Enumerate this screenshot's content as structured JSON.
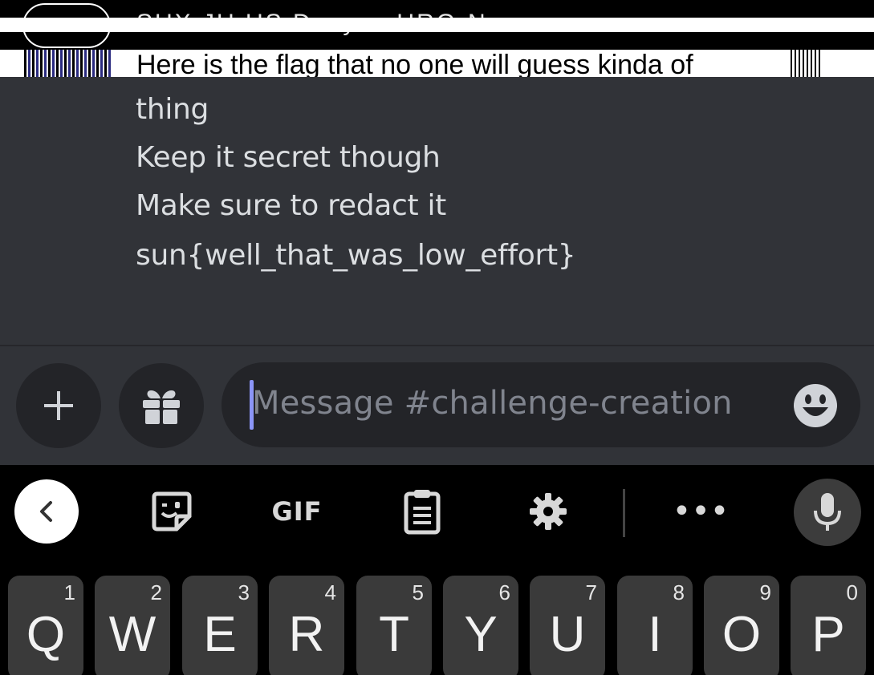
{
  "header": {
    "garbled_top": "SUX JU US Dcayaz URG-N",
    "garbled_line_prefix": "Here is the flag that no one will",
    "garbled_line_clear": " guess ",
    "garbled_line_suffix": "kinda of"
  },
  "message": {
    "lines": [
      "thing",
      "Keep it secret though",
      "Make sure to redact it",
      "sun{well_that_was_low_effort}"
    ]
  },
  "composer": {
    "placeholder": "Message #challenge-creation",
    "buttons": {
      "add_icon": "plus-icon",
      "gift_icon": "gift-icon",
      "emoji_icon": "emoji-icon"
    }
  },
  "keyboard_toolbar": {
    "gif_label": "GIF",
    "more_label": "•••",
    "icons": [
      "back-chevron-icon",
      "sticker-icon",
      "clipboard-icon",
      "settings-icon",
      "microphone-icon"
    ]
  },
  "keyboard_row": [
    {
      "letter": "Q",
      "hint": "1"
    },
    {
      "letter": "W",
      "hint": "2"
    },
    {
      "letter": "E",
      "hint": "3"
    },
    {
      "letter": "R",
      "hint": "4"
    },
    {
      "letter": "T",
      "hint": "5"
    },
    {
      "letter": "Y",
      "hint": "6"
    },
    {
      "letter": "U",
      "hint": "7"
    },
    {
      "letter": "I",
      "hint": "8"
    },
    {
      "letter": "O",
      "hint": "9"
    },
    {
      "letter": "P",
      "hint": "0"
    }
  ],
  "colors": {
    "chat_bg": "#313338",
    "input_bg": "#232428",
    "text": "#dbdee1",
    "placeholder": "#80848e",
    "caret": "#8b95f7",
    "key_bg": "#3a3a3a"
  }
}
